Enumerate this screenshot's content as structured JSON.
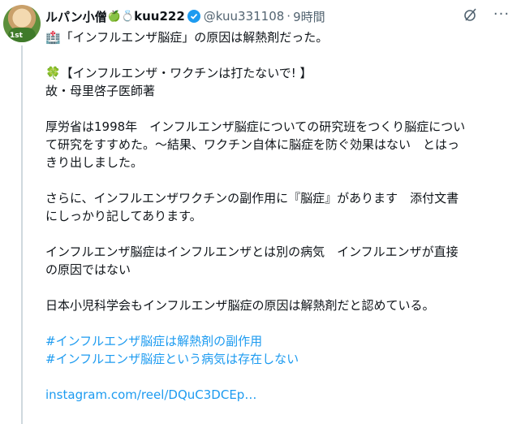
{
  "post": {
    "display_name": "ルパン小僧",
    "name_emoji": "🍏💍",
    "name_suffix": "kuu222",
    "handle": "@kuu331108",
    "separator": "·",
    "time": "9時間",
    "line1": "🏥「インフルエンザ脳症」の原因は解熱剤だった。",
    "line2": "🍀【インフルエンザ・ワクチンは打たないで! 】",
    "line3": "故・母里啓子医師著",
    "para1_l1": "厚労省は1998年　インフルエンザ脳症についての研究班をつくり脳症につい",
    "para1_l2": "て研究をすすめた。～結果、ワクチン自体に脳症を防ぐ効果はない　とはっ",
    "para1_l3": "きり出しました。",
    "para2_l1": "さらに、インフルエンザワクチンの副作用に『脳症』があります　添付文書",
    "para2_l2": "にしっかり記してあります。",
    "para3_l1": "インフルエンザ脳症はインフルエンザとは別の病気　インフルエンザが直接",
    "para3_l2": "の原因ではない",
    "para4": "日本小児科学会もインフルエンザ脳症の原因は解熱剤だと認めている。",
    "hashtag1": "#インフルエンザ脳症は解熱剤の副作用",
    "hashtag2": "#インフルエンザ脳症という病気は存在しない",
    "link": "instagram.com/reel/DQuC3DCEp…"
  },
  "avatar_badge": "1st",
  "icons": {
    "verified": "verified-badge-icon",
    "grok": "grok-icon",
    "more": "more-icon"
  },
  "colors": {
    "accent": "#1d9bf0",
    "muted": "#536471",
    "text": "#0f1419"
  }
}
